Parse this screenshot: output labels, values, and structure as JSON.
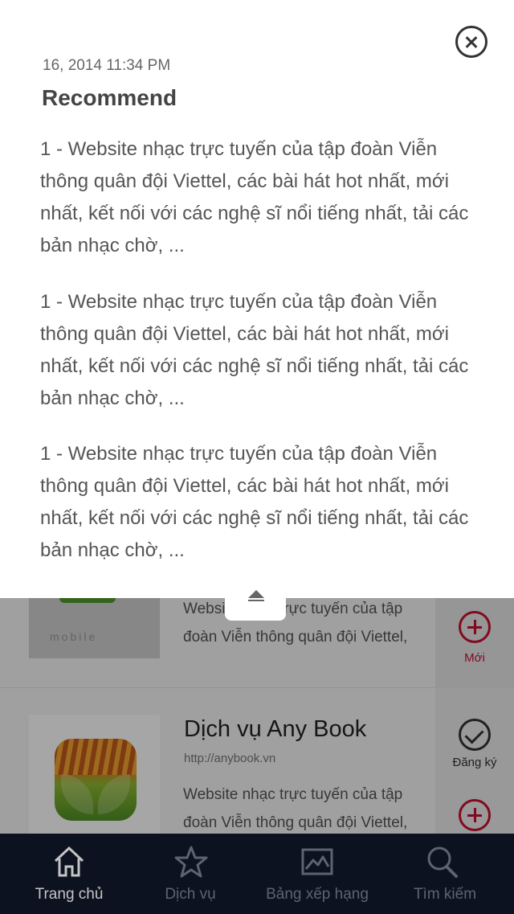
{
  "popup": {
    "date": "16, 2014 11:34 PM",
    "heading": "Recommend",
    "paragraphs": [
      "1 - Website nhạc trực tuyến của tập đoàn Viễn thông quân đội Viettel, các bài hát hot nhất, mới nhất, kết nối với các nghệ sĩ nổi tiếng nhất, tải các bản nhạc chờ, ...",
      "1 - Website nhạc trực tuyến của tập đoàn Viễn thông quân đội Viettel, các bài hát hot nhất, mới nhất, kết nối với các nghệ sĩ nổi tiếng nhất, tải các bản nhạc chờ, ...",
      "1 - Website nhạc trực tuyến của tập đoàn Viễn thông quân đội Viettel, các bài hát hot nhất, mới nhất, kết nối với các nghệ sĩ nổi tiếng nhất, tải các bản nhạc chờ, ..."
    ],
    "close_icon": "close-circle-icon",
    "collapse_icon": "eject-up-icon"
  },
  "apps": [
    {
      "logo_text": "mobile",
      "description": "Website nhạc trực tuyến của tập đoàn Viễn thông quân đội Viettel,",
      "side_label": "Mới"
    },
    {
      "title": "Dịch vụ Any Book",
      "url": "http://anybook.vn",
      "description": "Website nhạc trực tuyến của tập đoàn Viễn thông quân đội Viettel,",
      "side_label": "Đăng ký"
    }
  ],
  "tabbar": {
    "items": [
      {
        "label": "Trang chủ",
        "icon": "home-icon",
        "active": true
      },
      {
        "label": "Dịch vụ",
        "icon": "star-icon",
        "active": false
      },
      {
        "label": "Bảng xếp hạng",
        "icon": "chart-image-icon",
        "active": false
      },
      {
        "label": "Tìm kiếm",
        "icon": "search-icon",
        "active": false
      }
    ]
  },
  "colors": {
    "accent": "#c8102e",
    "tabbar_bg": "#0d1220",
    "tab_active": "#c4c4c4",
    "tab_inactive": "#5d6371"
  }
}
